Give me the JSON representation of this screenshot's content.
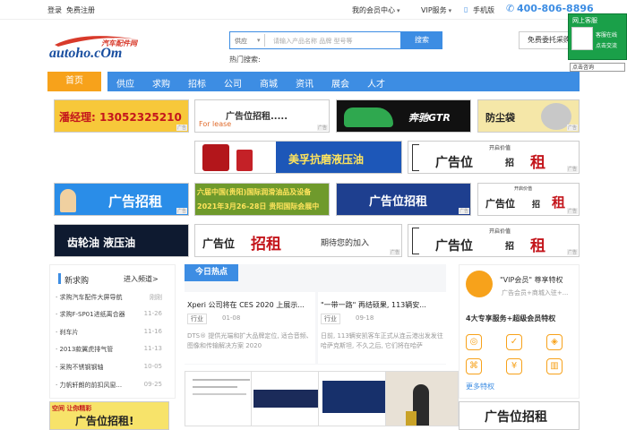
{
  "topbar": {
    "login": "登录",
    "register": "免费注册",
    "member_center": "我的会员中心",
    "vip_service": "VIP服务",
    "mobile": "手机版",
    "hotline": "400-806-8896"
  },
  "logo": {
    "text": "autoho.cOm",
    "tagline": "汽车配件网"
  },
  "search": {
    "category": "供应",
    "placeholder": "请输入产品名称 品牌 型号等",
    "button": "搜索",
    "hot_label": "热门搜索:",
    "entrust": "免费委托采购"
  },
  "nav": {
    "home": "首页",
    "items": [
      "供应",
      "求购",
      "招标",
      "公司",
      "商城",
      "资讯",
      "展会",
      "人才"
    ]
  },
  "ads": {
    "row1": [
      "潘经理: 13052325210",
      "广告位招租.....",
      "For lease",
      "奔驰GTR",
      "防尘袋"
    ],
    "row2": [
      "美孚抗磨液压油",
      "开启价值",
      "广告位",
      "招",
      "租"
    ],
    "row3": [
      "广告招租",
      "六届中国(贵阳)国际润滑油品及设备",
      "2021年3月26-28日 贵阳国际会展中",
      "广告位招租",
      "开启价值",
      "广告位",
      "招",
      "租"
    ],
    "row4": [
      "齿轮油  液压油",
      "广告位",
      "招租",
      "期待您的加入",
      "开启价值",
      "广告位",
      "招",
      "租"
    ],
    "tag": "广告",
    "bottom_left": [
      "空间 让你精彩",
      "广告位招租!"
    ],
    "bottom_right": [
      "广告位招租"
    ]
  },
  "demand": {
    "title": "新求购",
    "more": "进入频道>",
    "items": [
      {
        "text": "求购汽车配件大屏导航",
        "date": "刚刚"
      },
      {
        "text": "求购F-SP01进纸离合器",
        "date": "11-26"
      },
      {
        "text": "刹车片",
        "date": "11-16"
      },
      {
        "text": "2013款翼虎排气管",
        "date": "11-13"
      },
      {
        "text": "采购不锈钢钢轴",
        "date": "10-05"
      },
      {
        "text": "力帆轩朗的前扣风窗...",
        "date": "09-25"
      }
    ]
  },
  "news": {
    "tab": "今日热点",
    "cards": [
      {
        "title": "Xperi 公司将在 CES 2020 上展示...",
        "cat": "行业",
        "date": "01-08",
        "body": "DTS®   提供光端和扩大品牌定位, 适合音频、图像和传输解决方案     2020"
      },
      {
        "title": "\"一带一路\" 再结硕果, 113辆安...",
        "cat": "行业",
        "date": "09-18",
        "body": "日前, 113辆安凯客车正式从连云港出发发往哈萨克斯坦, 不久之后, 它们将在哈萨"
      }
    ]
  },
  "vip": {
    "title": "\"VIP会员\" 尊享特权",
    "subtitle": "广告会员+商城入驻+...",
    "heading": "4大专享服务+超级会员特权",
    "more": "更多特权"
  },
  "service": {
    "title": "网上客服",
    "online": "客服在线",
    "chat": "点击交流",
    "button": "点击咨询"
  }
}
